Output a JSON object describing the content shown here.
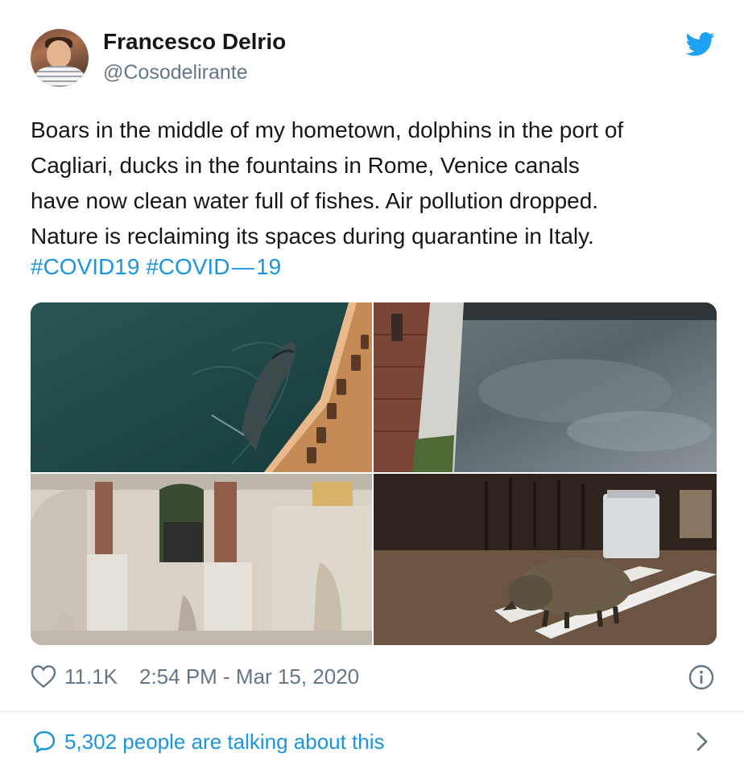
{
  "author": {
    "display_name": "Francesco Delrio",
    "handle": "@Cosodelirante"
  },
  "tweet": {
    "text_lines": [
      "Boars in the middle of my hometown, dolphins in the port of",
      "Cagliari, ducks in the fountains in Rome, Venice canals",
      "have now clean water full of fishes. Air pollution dropped.",
      "Nature is reclaiming its spaces during quarantine in Italy."
    ],
    "hashtags": [
      "#COVID19",
      "#COVID — 19"
    ]
  },
  "icons": {
    "brand": "twitter-bird-icon",
    "like": "heart-icon",
    "info": "info-icon",
    "reply": "speech-bubble-icon",
    "more": "chevron-right-icon"
  },
  "meta": {
    "like_count": "11.1K",
    "timestamp": "2:54 PM - Mar 15, 2020"
  },
  "conversation": {
    "label": "5,302 people are talking about this"
  },
  "colors": {
    "brand": "#1da1f2",
    "link": "#1b95e0",
    "text": "#14171a",
    "muted": "#657786",
    "divider": "#e1e8ed"
  }
}
